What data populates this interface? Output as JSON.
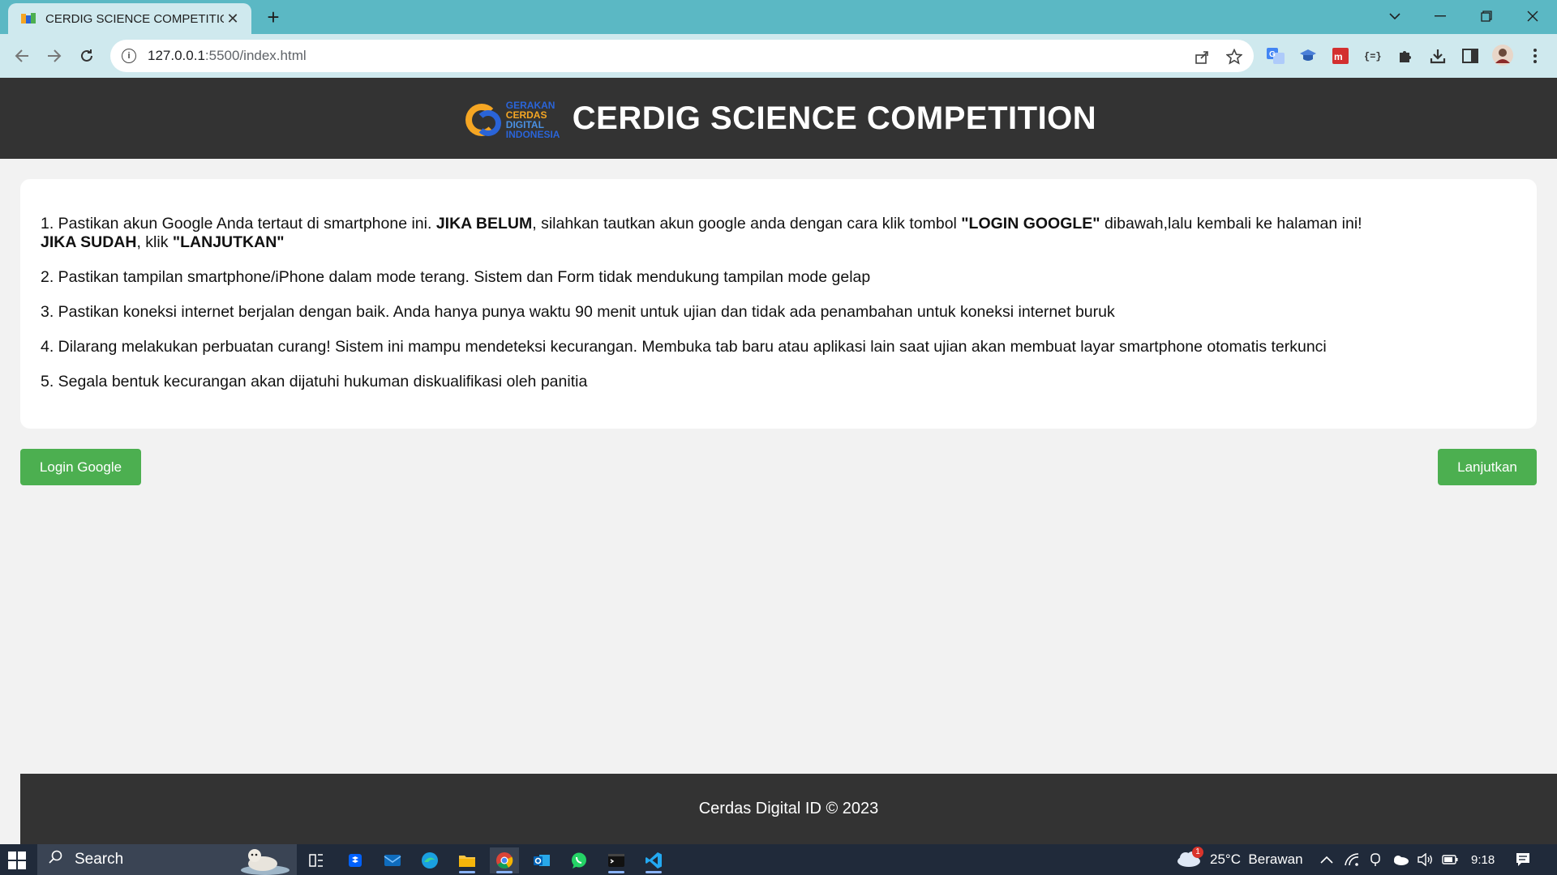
{
  "browser": {
    "tab_title": "CERDIG SCIENCE COMPETITION",
    "tab_close": "✕",
    "new_tab": "+",
    "url_host": "127.0.0.1",
    "url_path": ":5500/index.html"
  },
  "header": {
    "title": "CERDIG SCIENCE COMPETITION",
    "logo_lines": [
      "GERAKAN",
      "CERDAS",
      "DIGITAL",
      "INDONESIA"
    ]
  },
  "rules": [
    {
      "parts": [
        {
          "t": "1. Pastikan akun Google Anda tertaut di smartphone ini. "
        },
        {
          "t": "JIKA BELUM",
          "b": true
        },
        {
          "t": ", silahkan tautkan akun google anda dengan cara klik tombol "
        },
        {
          "t": "\"LOGIN GOOGLE\"",
          "b": true
        },
        {
          "t": " dibawah,lalu kembali ke halaman ini!"
        },
        {
          "br": true
        },
        {
          "t": "JIKA SUDAH",
          "b": true
        },
        {
          "t": ", klik "
        },
        {
          "t": "\"LANJUTKAN\"",
          "b": true
        }
      ]
    },
    {
      "parts": [
        {
          "t": "2. Pastikan tampilan smartphone/iPhone dalam mode terang. Sistem dan Form tidak mendukung tampilan mode gelap"
        }
      ]
    },
    {
      "parts": [
        {
          "t": "3. Pastikan koneksi internet berjalan dengan baik. Anda hanya punya waktu 90 menit untuk ujian dan tidak ada penambahan untuk koneksi internet buruk"
        }
      ]
    },
    {
      "parts": [
        {
          "t": "4. Dilarang melakukan perbuatan curang! Sistem ini mampu mendeteksi kecurangan. Membuka tab baru atau aplikasi lain saat ujian akan membuat layar smartphone otomatis terkunci"
        }
      ]
    },
    {
      "parts": [
        {
          "t": "5. Segala bentuk kecurangan akan dijatuhi hukuman diskualifikasi oleh panitia"
        }
      ]
    }
  ],
  "buttons": {
    "login": "Login Google",
    "next": "Lanjutkan"
  },
  "footer": {
    "text": "Cerdas Digital ID © 2023"
  },
  "taskbar": {
    "search_placeholder": "Search",
    "weather_badge": "1",
    "weather": "25°C  Berawan",
    "time": "9:18"
  },
  "colors": {
    "accent_green": "#4caf50",
    "header_bg": "#333333",
    "tab_strip": "#5bb8c4"
  }
}
